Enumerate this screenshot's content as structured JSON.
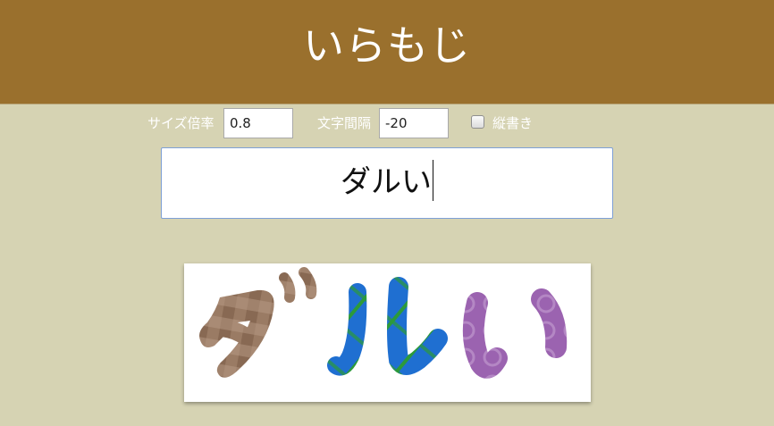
{
  "app": {
    "title": "いらもじ"
  },
  "controls": {
    "size_label": "サイズ倍率",
    "size_value": "0.8",
    "spacing_label": "文字間隔",
    "spacing_value": "-20",
    "vertical_label": "縦書き",
    "vertical_checked": false
  },
  "text_input": {
    "value": "ダルい"
  },
  "preview": {
    "characters": [
      {
        "char": "ダ",
        "pattern": "brown-plaid",
        "color": "#8d6e57"
      },
      {
        "char": "ル",
        "pattern": "blue-green-plaid",
        "color": "#1f6fd1"
      },
      {
        "char": "い",
        "pattern": "purple-dots",
        "color": "#9b63b0"
      }
    ]
  },
  "colors": {
    "header_bg": "#9a702d",
    "page_bg": "#d6d3b3",
    "input_border": "#7ea0d6"
  }
}
